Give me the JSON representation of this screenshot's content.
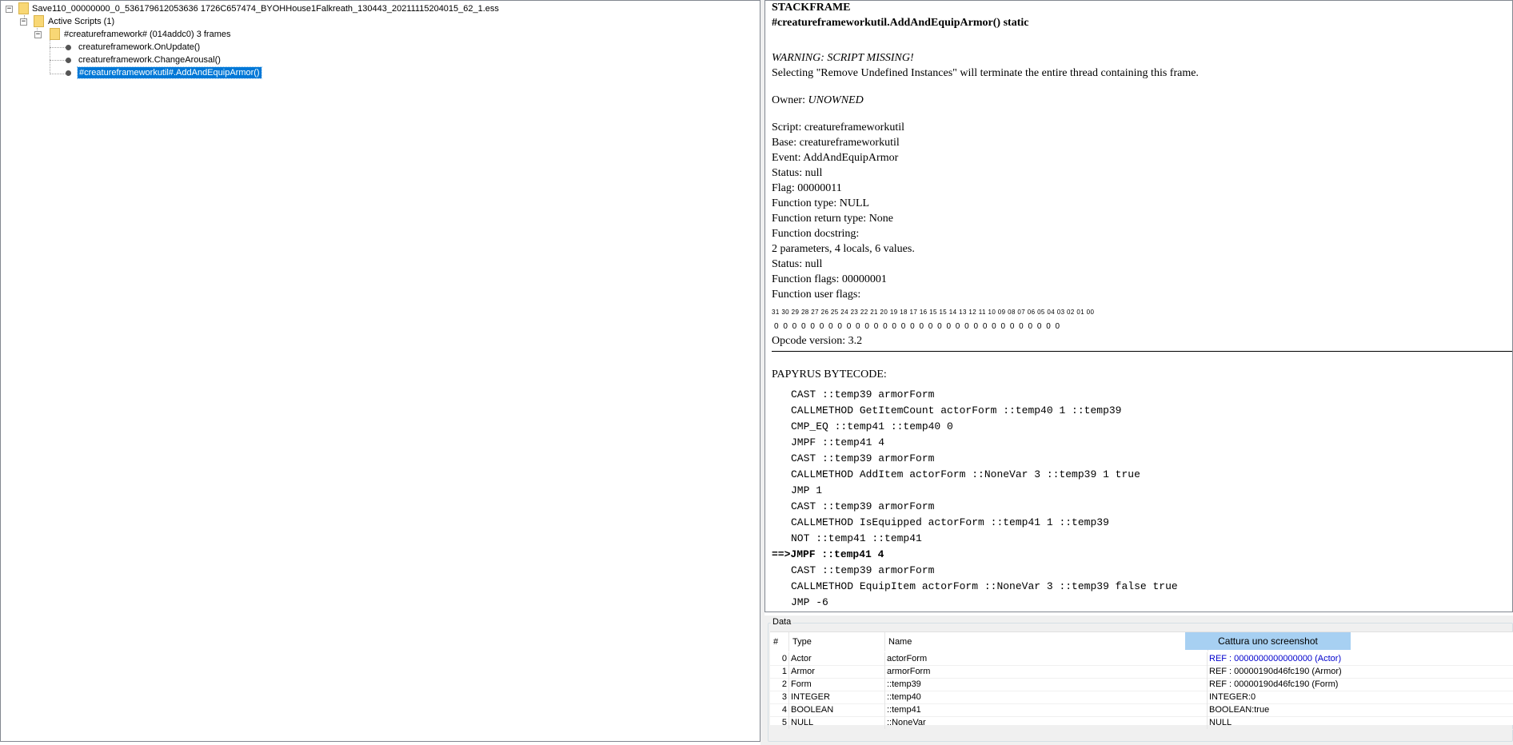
{
  "tree": {
    "root": "Save110_00000000_0_536179612053636 1726C657474_BYOHHouse1Falkreath_130443_20211115204015_62_1.ess",
    "active_scripts": "Active Scripts (1)",
    "thread": "#creatureframework# (014addc0) 3 frames",
    "frames": [
      "creatureframework.OnUpdate()",
      "creatureframework.ChangeArousal()",
      "#creatureframeworkutil#.AddAndEquipArmor()"
    ]
  },
  "info": {
    "heading": "STACKFRAME",
    "signature": "#creatureframeworkutil.AddAndEquipArmor() static",
    "warning": "WARNING: SCRIPT MISSING!",
    "warning_detail": "Selecting \"Remove Undefined Instances\" will terminate the entire thread containing this frame.",
    "owner_label": "Owner: ",
    "owner_value": "UNOWNED",
    "details": [
      "Script: creatureframeworkutil",
      "Base: creatureframeworkutil",
      "Event: AddAndEquipArmor",
      "Status: null",
      "Flag: 00000011",
      "Function type: NULL",
      "Function return type: None",
      "Function docstring:",
      "2 parameters, 4 locals, 6 values.",
      "Status: null",
      "Function flags: 00000001",
      "Function user flags:"
    ],
    "bit_indices": "31 30 29 28 27 26 25 24 23 22 21 20 19 18 17 16 15 15 14 13 12 11 10 09 08 07 06 05 04 03 02 01 00",
    "bit_values": "0 0 0 0 0 0 0 0 0 0 0 0 0 0 0 0 0 0 0 0 0 0 0 0 0 0 0 0 0 0 0 0",
    "opcode_version": "Opcode version: 3.2",
    "bytecode_heading": "PAPYRUS BYTECODE:",
    "bytecode": [
      "CAST ::temp39 armorForm",
      "CALLMETHOD GetItemCount actorForm ::temp40 1 ::temp39",
      "CMP_EQ ::temp41 ::temp40 0",
      "JMPF ::temp41 4",
      "CAST ::temp39 armorForm",
      "CALLMETHOD AddItem actorForm ::NoneVar 3 ::temp39 1 true",
      "JMP 1",
      "CAST ::temp39 armorForm",
      "CALLMETHOD IsEquipped actorForm ::temp41 1 ::temp39",
      "NOT ::temp41 ::temp41",
      "==>JMPF ::temp41 4",
      "CAST ::temp39 armorForm",
      "CALLMETHOD EquipItem actorForm ::NoneVar 3 ::temp39 false true",
      "JMP -6"
    ]
  },
  "data": {
    "title": "Data",
    "columns": [
      "#",
      "Type",
      "Name",
      ""
    ],
    "capture_button": "Cattura uno screenshot",
    "rows": [
      {
        "index": "0",
        "type": "Actor",
        "name": "actorForm",
        "value": "REF : 0000000000000000 (Actor)"
      },
      {
        "index": "1",
        "type": "Armor",
        "name": "armorForm",
        "value": "REF : 00000190d46fc190 (Armor)"
      },
      {
        "index": "2",
        "type": "Form",
        "name": "::temp39",
        "value": "REF : 00000190d46fc190 (Form)"
      },
      {
        "index": "3",
        "type": "INTEGER",
        "name": "::temp40",
        "value": "INTEGER:0"
      },
      {
        "index": "4",
        "type": "BOOLEAN",
        "name": "::temp41",
        "value": "BOOLEAN:true"
      },
      {
        "index": "5",
        "type": "NULL",
        "name": "::NoneVar",
        "value": "NULL"
      }
    ]
  },
  "colors": {
    "selection": "#0078d7",
    "link": "#0000cc",
    "capture_button": "#a7d0f2"
  }
}
